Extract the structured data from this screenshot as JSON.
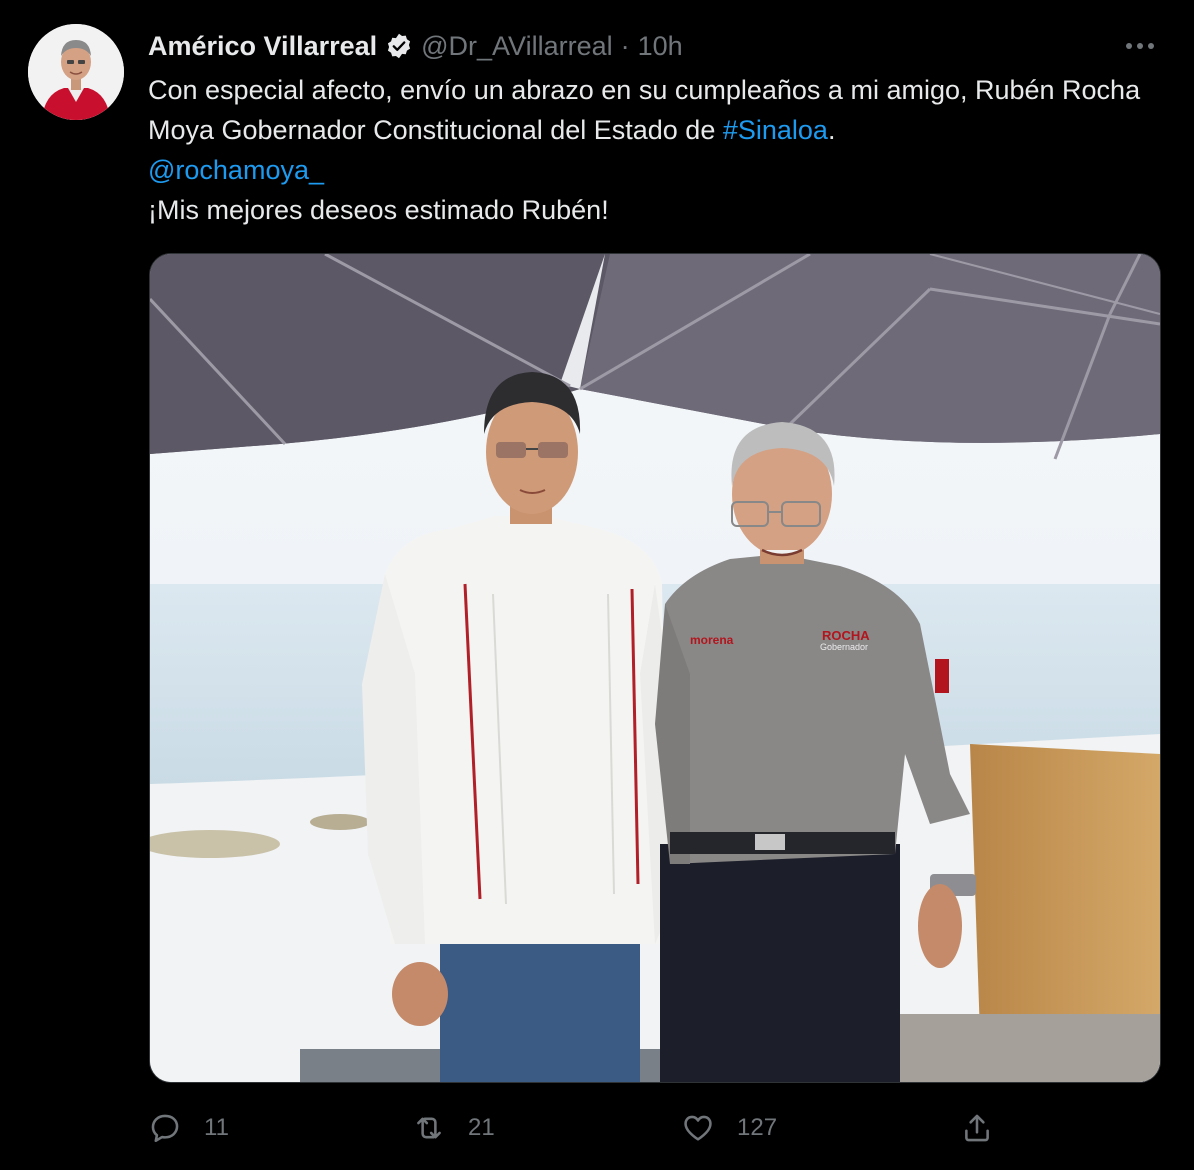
{
  "tweet": {
    "author": {
      "name": "Américo Villarreal",
      "handle": "@Dr_AVillarreal",
      "verified": true
    },
    "separator": "·",
    "time": "10h",
    "more_icon": "ellipsis-icon",
    "text": {
      "line1": "Con especial afecto, envío un abrazo en su cumpleaños a mi amigo, Rubén Rocha Moya Gobernador Constitucional del Estado de ",
      "hashtag": "#Sinaloa",
      "line1_end": ".",
      "mention": "@rochamoya_",
      "line3": "¡Mis mejores deseos estimado Rubén!"
    },
    "media": {
      "shirt_text_left": "morena",
      "shirt_text_right_top": "ROCHA",
      "shirt_text_right_bottom": "Gobernador"
    },
    "actions": {
      "reply_count": "11",
      "retweet_count": "21",
      "like_count": "127"
    }
  },
  "colors": {
    "background": "#000000",
    "text": "#e7e9ea",
    "secondary": "#71767b",
    "link": "#1d9bf0"
  }
}
